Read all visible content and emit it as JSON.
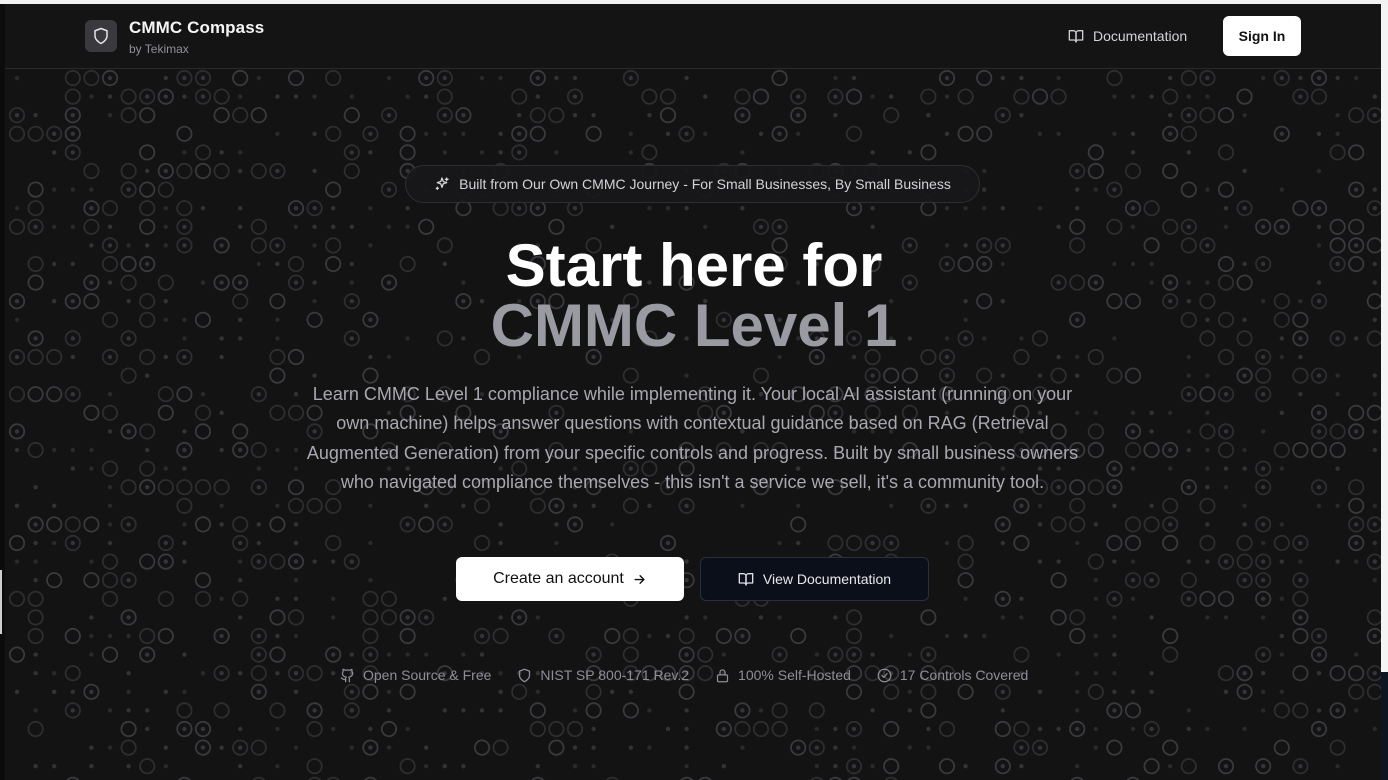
{
  "header": {
    "brand_title": "CMMC Compass",
    "brand_subtitle": "by Tekimax",
    "logo_icon": "shield-icon",
    "nav_documentation_label": "Documentation",
    "signin_label": "Sign In"
  },
  "hero": {
    "badge_text": "Built from Our Own CMMC Journey - For Small Businesses, By Small Business",
    "badge_icon": "sparkles-icon",
    "title_line1": "Start here for",
    "title_line2": "CMMC Level 1",
    "description": "Learn CMMC Level 1 compliance while implementing it. Your local AI assistant (running on your own machine) helps answer questions with contextual guidance based on RAG (Retrieval Augmented Generation) from your specific controls and progress. Built by small business owners who navigated compliance themselves - this isn't a service we sell, it's a community tool.",
    "primary_button_label": "Create an account",
    "secondary_button_label": "View Documentation"
  },
  "features": [
    {
      "icon": "github-icon",
      "label": "Open Source & Free"
    },
    {
      "icon": "shield-icon",
      "label": "NIST SP 800-171 Rev.2"
    },
    {
      "icon": "lock-icon",
      "label": "100% Self-Hosted"
    },
    {
      "icon": "check-circle-icon",
      "label": "17 Controls Covered"
    }
  ],
  "colors": {
    "background": "#131314",
    "accent_muted": "#9a9aa2",
    "text_primary": "#ffffff",
    "button_secondary_bg": "#0b0f1a"
  }
}
